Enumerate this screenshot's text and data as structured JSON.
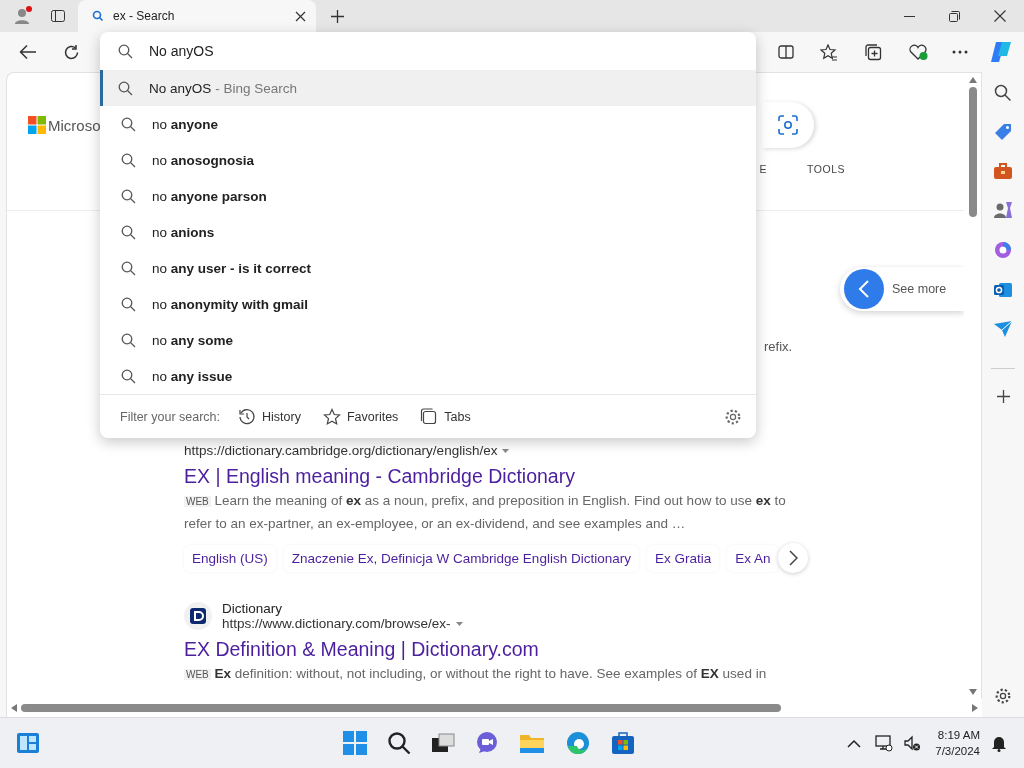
{
  "tabs": [
    {
      "title": "ex - Search",
      "selected": true
    }
  ],
  "address_dropdown": {
    "query": "No anyOS",
    "suggestions": [
      {
        "kind": "search",
        "text": "No anyOS",
        "hint": "- Bing Search",
        "selected": true
      },
      {
        "kind": "suggest",
        "text": "no **anyone**",
        "selected": false
      },
      {
        "kind": "suggest",
        "text": "no **anosognosia**",
        "selected": false
      },
      {
        "kind": "suggest",
        "text": "no **anyone parson**",
        "selected": false
      },
      {
        "kind": "suggest",
        "text": "no **anions**",
        "selected": false
      },
      {
        "kind": "suggest",
        "text": "no **any user - is it correct**",
        "selected": false
      },
      {
        "kind": "suggest",
        "text": "no **anonymity with gmail**",
        "selected": false
      },
      {
        "kind": "suggest",
        "text": "no **any some**",
        "selected": false
      },
      {
        "kind": "suggest",
        "text": "no **any issue**",
        "selected": false
      }
    ],
    "filter_label": "Filter your search:",
    "filters": [
      {
        "kind": "history",
        "label": "History"
      },
      {
        "kind": "favorites",
        "label": "Favorites"
      },
      {
        "kind": "tabs",
        "label": "Tabs"
      }
    ]
  },
  "page": {
    "logo": "Microso",
    "nav": [
      "E",
      "TOOLS"
    ],
    "see_more": "See more",
    "fragment": "refix.",
    "results": [
      {
        "url": "https://dictionary.cambridge.org/dictionary/english/ex",
        "title": "EX | English meaning - Cambridge Dictionary",
        "badge": "WEB",
        "snippet": "Learn the meaning of **ex** as a noun, prefix, and preposition in English. Find out how to use **ex** to refer to an ex-partner, an ex-employee, or an ex-dividend, and see examples and …",
        "chips": [
          "English (US)",
          "Znaczenie Ex, Definicja W Cambridge English Dictionary",
          "Ex Gratia",
          "Ex An"
        ]
      },
      {
        "site": "Dictionary",
        "url": "https://www.dictionary.com/browse/ex-",
        "title": "EX Definition & Meaning | Dictionary.com",
        "badge": "WEB",
        "snippet": "**Ex** definition: without, not including, or without the right to have. See examples of **EX** used in"
      }
    ]
  },
  "taskbar": {
    "time": "8:19 AM",
    "date": "7/3/2024"
  }
}
